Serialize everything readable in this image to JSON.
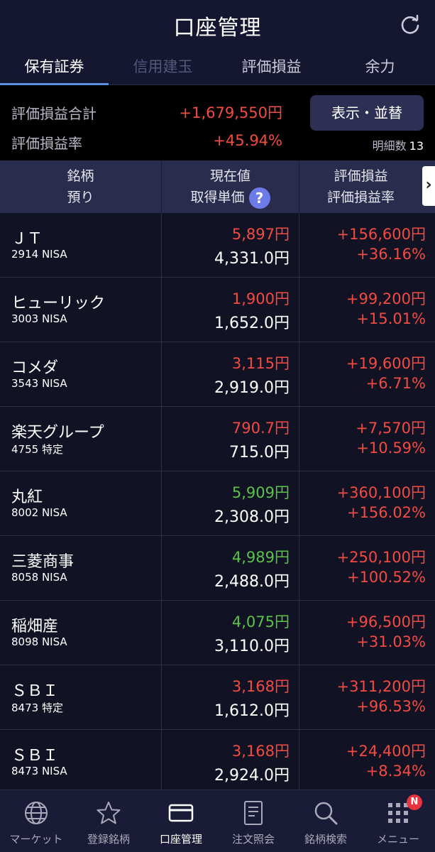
{
  "header": {
    "title": "口座管理"
  },
  "tabs": [
    {
      "label": "保有証券",
      "state": "active"
    },
    {
      "label": "信用建玉",
      "state": "disabled"
    },
    {
      "label": "評価損益",
      "state": "normal"
    },
    {
      "label": "余力",
      "state": "normal"
    }
  ],
  "summary": {
    "total_label": "評価損益合計",
    "total_value": "+1,679,550円",
    "rate_label": "評価損益率",
    "rate_value": "+45.94%",
    "view_button": "表示・並替",
    "count_label": "明細数",
    "count_value": "13"
  },
  "columns": {
    "c1_line1": "銘柄",
    "c1_line2": "預り",
    "c2_line1": "現在値",
    "c2_line2": "取得単価",
    "c3_line1": "評価損益",
    "c3_line2": "評価損益率",
    "help": "?",
    "more": "›"
  },
  "colors": {
    "red": "#f24b41",
    "green": "#5bc24a",
    "accent": "#5a8fe0",
    "badge": "#e8343f"
  },
  "rows": [
    {
      "name": "ＪＴ",
      "sub": "2914 NISA",
      "price": "5,897円",
      "price_color": "#f24b41",
      "cost": "4,331.0円",
      "pl": "+156,600円",
      "plr": "+36.16%"
    },
    {
      "name": "ヒューリック",
      "sub": "3003 NISA",
      "price": "1,900円",
      "price_color": "#f24b41",
      "cost": "1,652.0円",
      "pl": "+99,200円",
      "plr": "+15.01%"
    },
    {
      "name": "コメダ",
      "sub": "3543 NISA",
      "price": "3,115円",
      "price_color": "#f24b41",
      "cost": "2,919.0円",
      "pl": "+19,600円",
      "plr": "+6.71%"
    },
    {
      "name": "楽天グループ",
      "sub": "4755 特定",
      "price": "790.7円",
      "price_color": "#f24b41",
      "cost": "715.0円",
      "pl": "+7,570円",
      "plr": "+10.59%"
    },
    {
      "name": "丸紅",
      "sub": "8002 NISA",
      "price": "5,909円",
      "price_color": "#5bc24a",
      "cost": "2,308.0円",
      "pl": "+360,100円",
      "plr": "+156.02%"
    },
    {
      "name": "三菱商事",
      "sub": "8058 NISA",
      "price": "4,989円",
      "price_color": "#5bc24a",
      "cost": "2,488.0円",
      "pl": "+250,100円",
      "plr": "+100.52%"
    },
    {
      "name": "稲畑産",
      "sub": "8098 NISA",
      "price": "4,075円",
      "price_color": "#5bc24a",
      "cost": "3,110.0円",
      "pl": "+96,500円",
      "plr": "+31.03%"
    },
    {
      "name": "ＳＢＩ",
      "sub": "8473 特定",
      "price": "3,168円",
      "price_color": "#f24b41",
      "cost": "1,612.0円",
      "pl": "+311,200円",
      "plr": "+96.53%"
    },
    {
      "name": "ＳＢＩ",
      "sub": "8473 NISA",
      "price": "3,168円",
      "price_color": "#f24b41",
      "cost": "2,924.0円",
      "pl": "+24,400円",
      "plr": "+8.34%"
    }
  ],
  "bottom_nav": [
    {
      "label": "マーケット",
      "icon": "globe-icon"
    },
    {
      "label": "登録銘柄",
      "icon": "star-icon"
    },
    {
      "label": "口座管理",
      "icon": "card-icon",
      "active": true
    },
    {
      "label": "注文照会",
      "icon": "document-icon"
    },
    {
      "label": "銘柄検索",
      "icon": "search-icon"
    },
    {
      "label": "メニュー",
      "icon": "grid-menu-icon",
      "badge": "N"
    }
  ]
}
